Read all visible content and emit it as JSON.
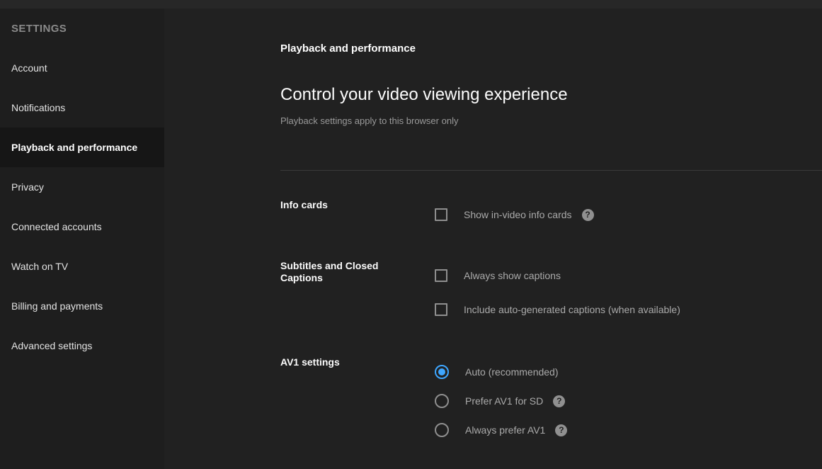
{
  "accent_color": "#3ea6ff",
  "top_bar": {},
  "sidebar": {
    "header": "SETTINGS",
    "items": [
      {
        "label": "Account",
        "selected": false
      },
      {
        "label": "Notifications",
        "selected": false
      },
      {
        "label": "Playback and performance",
        "selected": true
      },
      {
        "label": "Privacy",
        "selected": false
      },
      {
        "label": "Connected accounts",
        "selected": false
      },
      {
        "label": "Watch on TV",
        "selected": false
      },
      {
        "label": "Billing and payments",
        "selected": false
      },
      {
        "label": "Advanced settings",
        "selected": false
      }
    ]
  },
  "main": {
    "category_title": "Playback and performance",
    "heading": "Control your video viewing experience",
    "subheading": "Playback settings apply to this browser only",
    "help_glyph": "?",
    "sections": [
      {
        "label": "Info cards",
        "options": [
          {
            "type": "checkbox",
            "label": "Show in-video info cards",
            "checked": false,
            "has_help": true
          }
        ]
      },
      {
        "label": "Subtitles and Closed Captions",
        "options": [
          {
            "type": "checkbox",
            "label": "Always show captions",
            "checked": false,
            "has_help": false
          },
          {
            "type": "checkbox",
            "label": "Include auto-generated captions (when available)",
            "checked": false,
            "has_help": false
          }
        ]
      },
      {
        "label": "AV1 settings",
        "options": [
          {
            "type": "radio",
            "label": "Auto (recommended)",
            "selected": true,
            "has_help": false
          },
          {
            "type": "radio",
            "label": "Prefer AV1 for SD",
            "selected": false,
            "has_help": true
          },
          {
            "type": "radio",
            "label": "Always prefer AV1",
            "selected": false,
            "has_help": true
          }
        ]
      }
    ]
  }
}
